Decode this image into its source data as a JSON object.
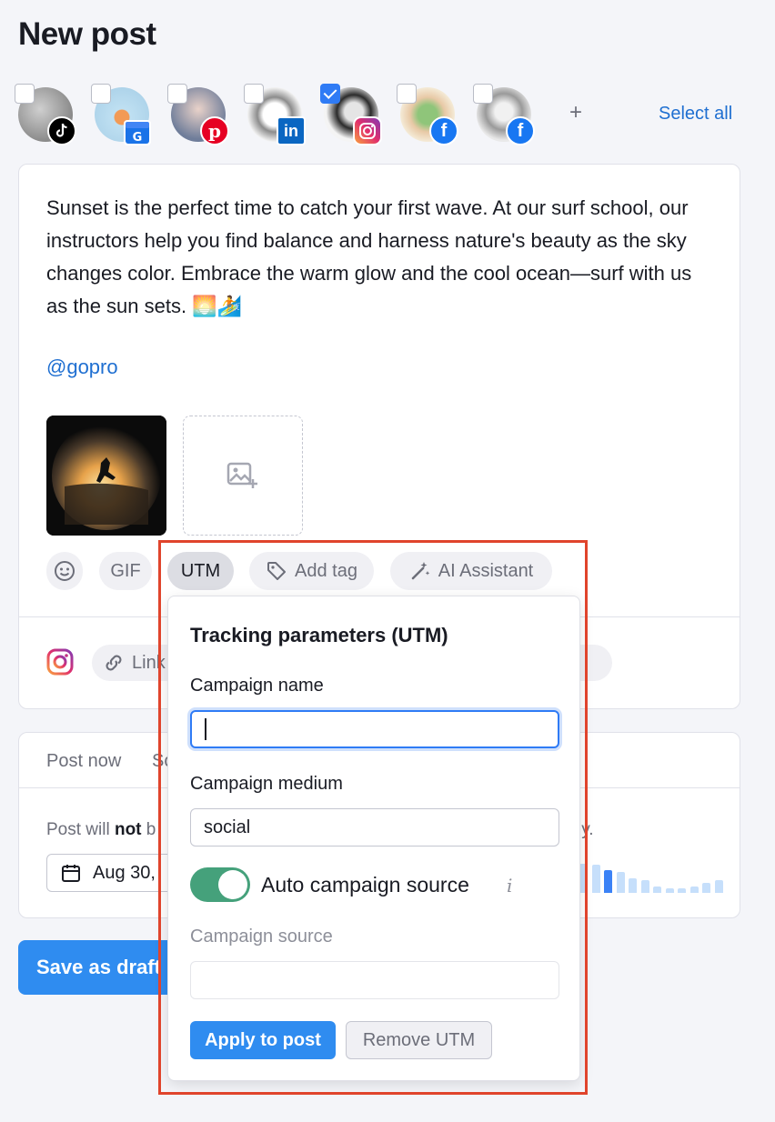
{
  "page": {
    "title": "New post"
  },
  "accounts": {
    "items": [
      {
        "network": "tiktok",
        "checked": false
      },
      {
        "network": "google-business",
        "checked": false
      },
      {
        "network": "pinterest",
        "checked": false
      },
      {
        "network": "linkedin",
        "checked": false
      },
      {
        "network": "instagram",
        "checked": true
      },
      {
        "network": "facebook",
        "checked": false
      },
      {
        "network": "facebook",
        "checked": false
      }
    ],
    "add_symbol": "+",
    "select_all_label": "Select all"
  },
  "composer": {
    "text": "Sunset is the perfect time to catch your first wave. At our surf school, our instructors help you find balance and harness nature's beauty as the sky changes color. Embrace the warm glow and the cool ocean—surf with us as the sun sets. 🌅🏄",
    "mention": "@gopro",
    "toolbar": {
      "gif_label": "GIF",
      "utm_label": "UTM",
      "add_tag_label": "Add tag",
      "ai_assistant_label": "AI Assistant"
    },
    "link_label": "Link"
  },
  "scheduling": {
    "tab_post_now": "Post now",
    "tab_schedule": "Sc",
    "notice_prefix": "Post will ",
    "notice_bold": "not",
    "notice_tail": " b",
    "notice_end": "ly.",
    "date_value": "Aug 30,",
    "activity_levels": [
      0.9,
      0.85,
      0.7,
      0.65,
      0.45,
      0.4,
      0.2,
      0.15,
      0.15,
      0.2,
      0.3,
      0.4
    ]
  },
  "save_draft_label": "Save as draft",
  "utm_popover": {
    "title": "Tracking parameters (UTM)",
    "campaign_name_label": "Campaign name",
    "campaign_name_value": "",
    "campaign_medium_label": "Campaign medium",
    "campaign_medium_value": "social",
    "auto_source_label": "Auto campaign source",
    "auto_source_enabled": true,
    "info_symbol": "i",
    "campaign_source_label": "Campaign source",
    "campaign_source_value": "",
    "apply_label": "Apply to post",
    "remove_label": "Remove UTM"
  },
  "colors": {
    "accent": "#2f8cf0",
    "link": "#1f6fd1",
    "toggle_on": "#45a17b",
    "highlight": "#e0442c"
  }
}
